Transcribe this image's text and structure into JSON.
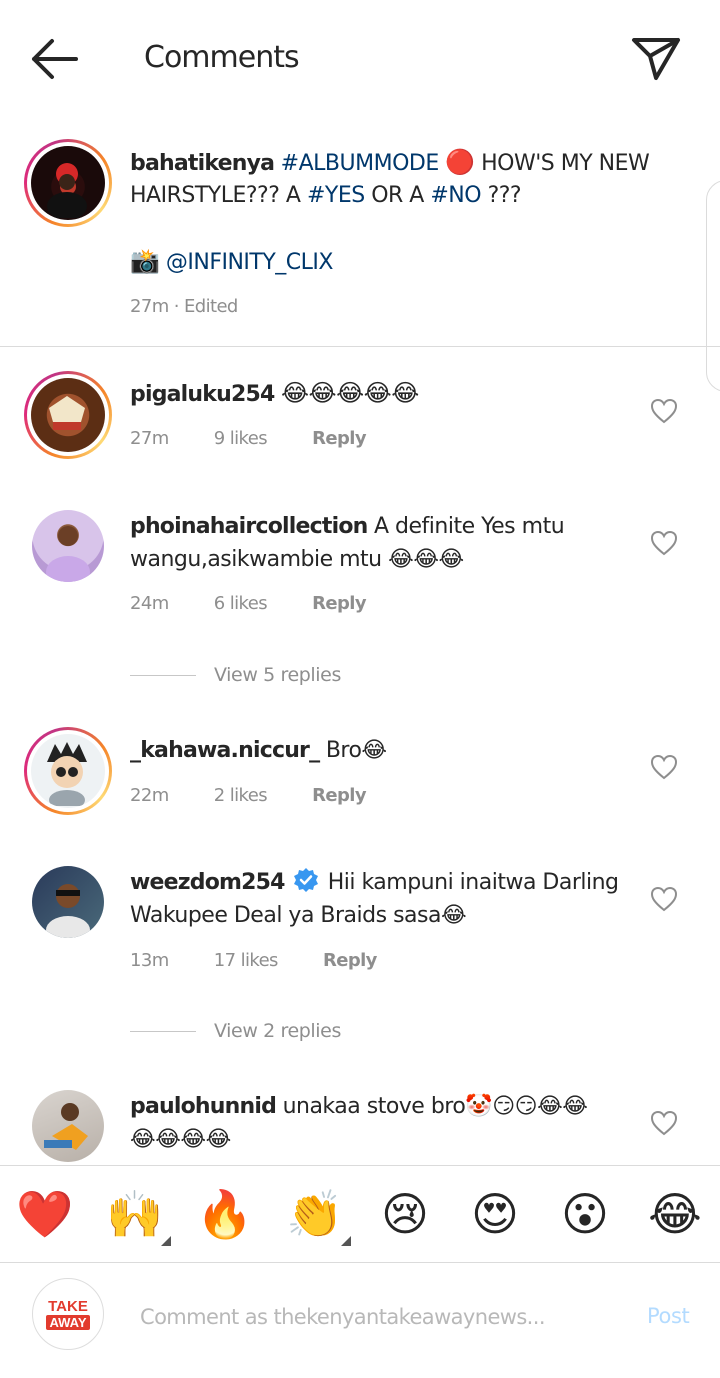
{
  "header": {
    "title": "Comments"
  },
  "caption": {
    "username": "bahatikenya",
    "line1_tag": "#ALBUMMODE",
    "line1_emoji": "🔴",
    "line1_text": "HOW'S MY  NEW",
    "line2_a": "HAIRSTYLE??? A",
    "line2_tag_yes": "#YES",
    "line2_mid": "OR A",
    "line2_tag_no": "#NO",
    "line2_end": "???",
    "line3_emoji": "📸",
    "line3_mention": "@INFINITY_CLIX",
    "meta": "27m · Edited"
  },
  "comments": [
    {
      "username": "pigaluku254",
      "line1": "😂😂😂😂😂",
      "line2": "",
      "time": "27m",
      "likes": "9 likes",
      "reply": "Reply"
    },
    {
      "username": "phoinahaircollection",
      "line1": "A definite Yes mtu",
      "line2": "wangu,asikwambie mtu 😂😂😂",
      "time": "24m",
      "likes": "6 likes",
      "reply": "Reply",
      "view_replies": "View 5 replies"
    },
    {
      "username": "_kahawa.niccur_",
      "line1": "Bro😂",
      "line2": "",
      "time": "22m",
      "likes": "2 likes",
      "reply": "Reply"
    },
    {
      "username": "weezdom254",
      "verified": true,
      "line1": "Hii kampuni inaitwa Darling",
      "line2": "Wakupee Deal ya Braids sasa😂",
      "time": "13m",
      "likes": "17 likes",
      "reply": "Reply",
      "view_replies": "View 2 replies"
    },
    {
      "username": "paulohunnid",
      "line1": "unakaa stove bro🤡😏😏😂😂",
      "line2": "😂😂😂😂"
    }
  ],
  "reactions": [
    "❤️",
    "🙌",
    "🔥",
    "👏",
    "😢",
    "😍",
    "😮",
    "😂"
  ],
  "composer": {
    "avatar_line1": "TAKE",
    "avatar_line2": "AWAY",
    "placeholder": "Comment as thekenyantakeawaynews...",
    "post_label": "Post"
  },
  "colors": {
    "link": "#00376b",
    "muted": "#8e8e8e",
    "post_disabled": "#b3dbff",
    "verified": "#3897f0"
  }
}
